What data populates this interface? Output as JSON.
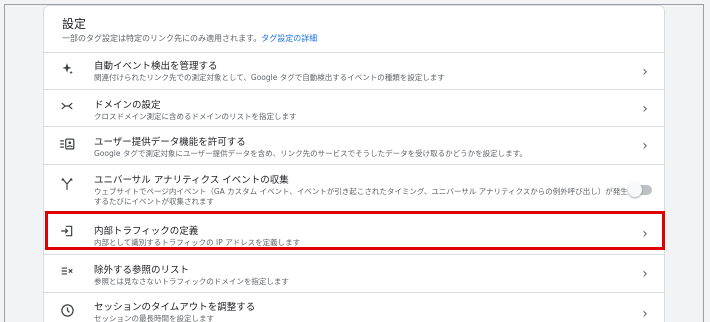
{
  "settings": {
    "title": "設定",
    "description": "一部のタグ設定は特定のリンク先にのみ適用されます。",
    "link_label": "タグ設定の詳細",
    "rows": [
      {
        "icon": "sparkle-icon",
        "title": "自動イベント検出を管理する",
        "description": "関連付けられたリンク先での測定対象として、Google タグで自動検出するイベントの種類を設定します",
        "action": "chevron"
      },
      {
        "icon": "merge-arrows-icon",
        "title": "ドメインの設定",
        "description": "クロスドメイン測定に含めるドメインのリストを指定します",
        "action": "chevron"
      },
      {
        "icon": "user-data-icon",
        "title": "ユーザー提供データ機能を許可する",
        "description": "Google タグで測定対象にユーザー提供データを含め、リンク先のサービスでそうしたデータを受け取るかどうかを設定します。",
        "action": "chevron"
      },
      {
        "icon": "fork-icon",
        "title": "ユニバーサル アナリティクス イベントの収集",
        "description": "ウェブサイトでページ内イベント（GA カスタム イベント、イベントが引き起こされたタイミング、ユニバーサル アナリティクスからの例外呼び出し）が発生するたびにイベントが収集されます",
        "action": "toggle",
        "toggle_on": false
      },
      {
        "icon": "login-icon",
        "title": "内部トラフィックの定義",
        "description": "内部として識別するトラフィックの IP アドレスを定義します",
        "action": "chevron"
      },
      {
        "icon": "list-exclude-icon",
        "title": "除外する参照のリスト",
        "description": "参照とは見なさないトラフィックのドメインを指定します",
        "action": "chevron"
      },
      {
        "icon": "clock-icon",
        "title": "セッションのタイムアウトを調整する",
        "description": "セッションの最長時間を設定します",
        "action": "chevron"
      }
    ]
  },
  "colors": {
    "highlight": "#e00000",
    "link": "#1a73e8"
  }
}
